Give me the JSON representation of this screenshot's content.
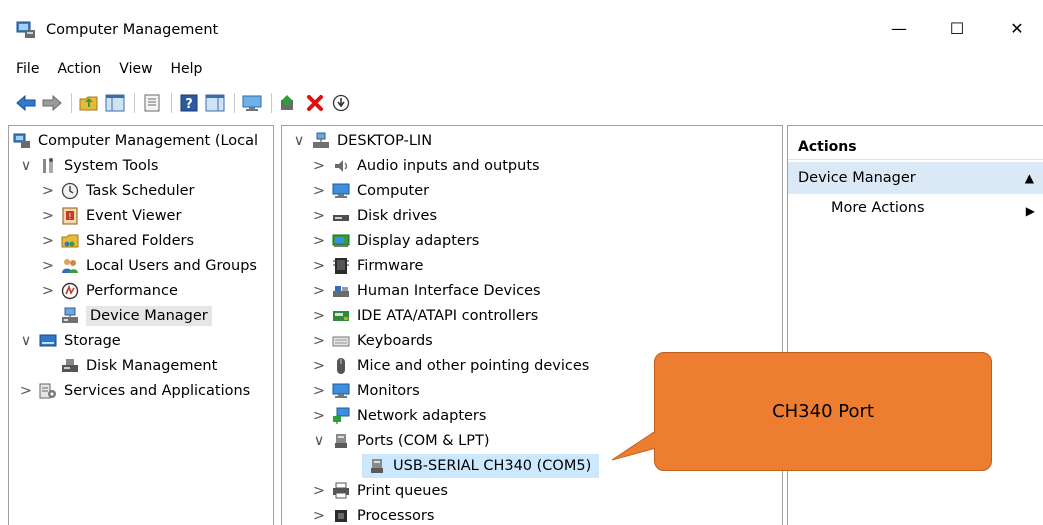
{
  "window": {
    "title": "Computer Management",
    "minimize_glyph": "—",
    "maximize_glyph": "☐",
    "close_glyph": "✕"
  },
  "menu": [
    "File",
    "Action",
    "View",
    "Help"
  ],
  "toolbar": {
    "icons": [
      "back-arrow-icon",
      "forward-arrow-icon",
      "up-folder-icon",
      "show-hide-tree-icon",
      "properties-icon",
      "help-icon",
      "show-hide-action-pane-icon",
      "monitor-icon",
      "update-driver-icon",
      "uninstall-icon",
      "scan-hardware-icon"
    ]
  },
  "left_tree": {
    "items": [
      {
        "label": "Computer Management (Local",
        "icon": "computer-management-icon",
        "chevron": "",
        "indent": 0
      },
      {
        "label": "System Tools",
        "icon": "system-tools-icon",
        "chevron": "v",
        "indent": 1
      },
      {
        "label": "Task Scheduler",
        "icon": "clock-icon",
        "chevron": ">",
        "indent": 2
      },
      {
        "label": "Event Viewer",
        "icon": "event-viewer-icon",
        "chevron": ">",
        "indent": 2
      },
      {
        "label": "Shared Folders",
        "icon": "shared-folder-icon",
        "chevron": ">",
        "indent": 2
      },
      {
        "label": "Local Users and Groups",
        "icon": "users-icon",
        "chevron": ">",
        "indent": 2
      },
      {
        "label": "Performance",
        "icon": "performance-icon",
        "chevron": ">",
        "indent": 2
      },
      {
        "label": "Device Manager",
        "icon": "device-manager-icon",
        "chevron": "",
        "indent": 2,
        "selected": true
      },
      {
        "label": "Storage",
        "icon": "storage-icon",
        "chevron": "v",
        "indent": 1
      },
      {
        "label": "Disk Management",
        "icon": "disk-management-icon",
        "chevron": "",
        "indent": 2
      },
      {
        "label": "Services and Applications",
        "icon": "services-icon",
        "chevron": ">",
        "indent": 1
      }
    ]
  },
  "device_tree": {
    "root": "DESKTOP-LIN",
    "items": [
      {
        "label": "Audio inputs and outputs",
        "icon": "speaker-icon",
        "chevron": ">"
      },
      {
        "label": "Computer",
        "icon": "computer-icon",
        "chevron": ">"
      },
      {
        "label": "Disk drives",
        "icon": "disk-drive-icon",
        "chevron": ">"
      },
      {
        "label": "Display adapters",
        "icon": "display-adapter-icon",
        "chevron": ">"
      },
      {
        "label": "Firmware",
        "icon": "firmware-icon",
        "chevron": ">"
      },
      {
        "label": "Human Interface Devices",
        "icon": "hid-icon",
        "chevron": ">"
      },
      {
        "label": "IDE ATA/ATAPI controllers",
        "icon": "ide-controller-icon",
        "chevron": ">"
      },
      {
        "label": "Keyboards",
        "icon": "keyboard-icon",
        "chevron": ">"
      },
      {
        "label": "Mice and other pointing devices",
        "icon": "mouse-icon",
        "chevron": ">"
      },
      {
        "label": "Monitors",
        "icon": "monitor-icon",
        "chevron": ">"
      },
      {
        "label": "Network adapters",
        "icon": "network-adapter-icon",
        "chevron": ">"
      },
      {
        "label": "Ports (COM & LPT)",
        "icon": "port-icon",
        "chevron": "v"
      },
      {
        "label": "USB-SERIAL CH340 (COM5)",
        "icon": "port-icon",
        "chevron": "",
        "child": true,
        "selected": true
      },
      {
        "label": "Print queues",
        "icon": "printer-icon",
        "chevron": ">"
      },
      {
        "label": "Processors",
        "icon": "processor-icon",
        "chevron": ">"
      }
    ]
  },
  "actions": {
    "header": "Actions",
    "section": "Device Manager",
    "more": "More Actions"
  },
  "callout": {
    "text": "CH340 Port",
    "color": "#ed7d31"
  }
}
